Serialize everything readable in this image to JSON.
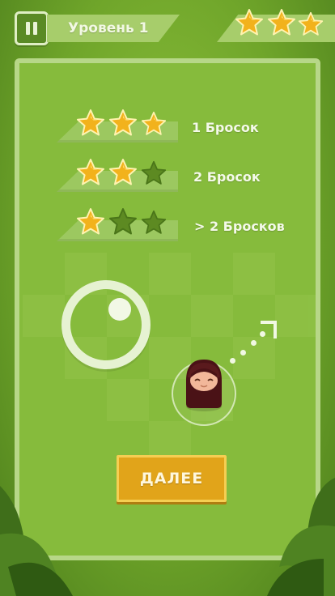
{
  "header": {
    "level_title": "Уровень 1",
    "earned_stars": 3,
    "max_stars": 3
  },
  "score_table": [
    {
      "label": "1 Бросок",
      "stars": 3
    },
    {
      "label": "2 Бросок",
      "stars": 2
    },
    {
      "label": "> 2 Бросков",
      "stars": 1
    }
  ],
  "buttons": {
    "next_label": "ДАЛЕЕ",
    "pause_icon": "pause-icon"
  },
  "colors": {
    "star_gold": "#f2b21c",
    "star_empty": "#5d8a22",
    "button": "#e1a41a",
    "panel": "#86bb3c"
  }
}
